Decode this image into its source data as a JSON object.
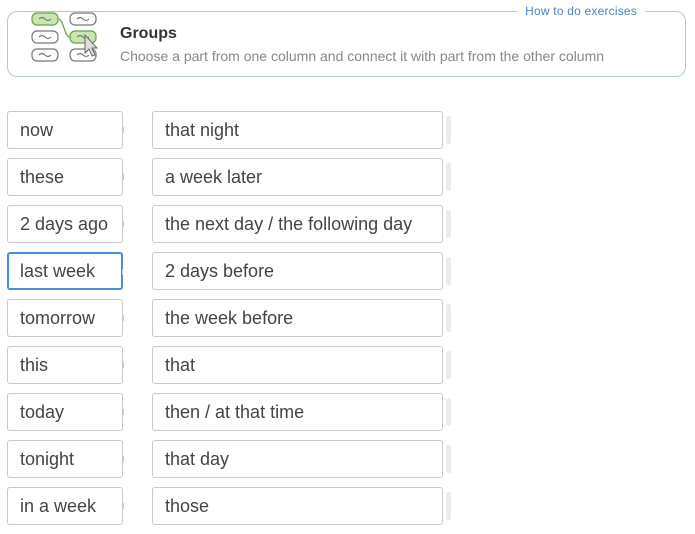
{
  "instructions": {
    "how_to_link": "How to do exercises",
    "title": "Groups",
    "text": "Choose a part from one column and connect it with part from the other column"
  },
  "left_column": [
    {
      "label": "now"
    },
    {
      "label": "these"
    },
    {
      "label": "2 days ago"
    },
    {
      "label": "last week",
      "selected": true
    },
    {
      "label": "tomorrow"
    },
    {
      "label": "this"
    },
    {
      "label": "today"
    },
    {
      "label": "tonight"
    },
    {
      "label": "in a week"
    }
  ],
  "right_column": [
    {
      "label": "that night"
    },
    {
      "label": "a week later"
    },
    {
      "label": "the next day / the following day"
    },
    {
      "label": "2 days before"
    },
    {
      "label": "the week before"
    },
    {
      "label": "that"
    },
    {
      "label": "then / at that time"
    },
    {
      "label": "that day"
    },
    {
      "label": "those"
    }
  ],
  "colors": {
    "accent_border": "#4a90d9",
    "frame_border": "#a9cbe6",
    "link": "#4a86bf",
    "logo_green": "#c9e6b0"
  }
}
